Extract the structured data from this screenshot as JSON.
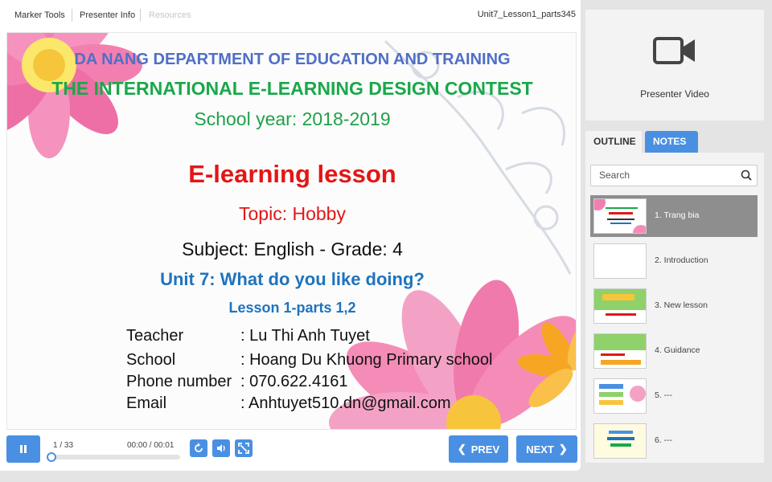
{
  "topbar": {
    "tab_marker": "Marker Tools",
    "tab_presenter": "Presenter Info",
    "tab_resources": "Resources",
    "project_title": "Unit7_Lesson1_parts345"
  },
  "slide": {
    "dept": "DA NANG DEPARTMENT OF EDUCATION AND TRAINING",
    "contest": "THE INTERNATIONAL E-LEARNING DESIGN CONTEST",
    "year": "School year: 2018-2019",
    "lesson_title": "E-learning lesson",
    "topic": "Topic: Hobby",
    "subject": "Subject: English - Grade: 4",
    "unit": "Unit 7: What do you like doing?",
    "parts": "Lesson 1-parts 1,2",
    "teacher_label": "Teacher",
    "teacher_value": ": Lu Thi Anh Tuyet",
    "school_label": "School",
    "school_value": ": Hoang Du Khuong  Primary school",
    "phone_label": "Phone number",
    "phone_value": ": 070.622.4161",
    "email_label": "Email",
    "email_value": ": Anhtuyet510.dn@gmail.com"
  },
  "controls": {
    "counter": "1 / 33",
    "time": "00:00 / 00:01",
    "progress": 0.0,
    "prev_label": "PREV",
    "next_label": "NEXT"
  },
  "sidebar": {
    "video_label": "Presenter Video",
    "tab_outline": "OUTLINE",
    "tab_notes": "NOTES",
    "search_placeholder": "Search",
    "items": [
      {
        "label": "1. Trang bia",
        "active": true
      },
      {
        "label": "2. Introduction",
        "active": false
      },
      {
        "label": "3. New lesson",
        "active": false
      },
      {
        "label": "4. Guidance",
        "active": false
      },
      {
        "label": "5. ---",
        "active": false
      },
      {
        "label": "6. ---",
        "active": false
      }
    ]
  },
  "colors": {
    "accent": "#4a90e2",
    "title_red": "#e31616",
    "title_green": "#19a84a",
    "title_blue": "#1e73be"
  }
}
